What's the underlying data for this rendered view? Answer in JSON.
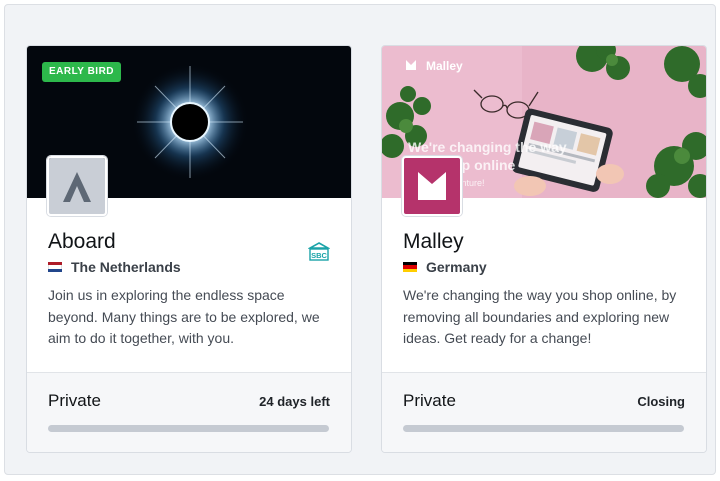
{
  "cards": [
    {
      "badge": "EARLY BIRD",
      "name": "Aboard",
      "country": "The Netherlands",
      "flag_colors": [
        "#ae1c28",
        "#ffffff",
        "#21468b"
      ],
      "description": "Join us in exploring the endless space beyond. Many things are to be explored, we aim to do it together, with you.",
      "badge_icon": "sbc-icon",
      "type": "Private",
      "status": "24 days left",
      "progress": 0
    },
    {
      "name": "Malley",
      "country": "Germany",
      "flag_colors": [
        "#000000",
        "#dd0000",
        "#ffce00"
      ],
      "description": "We're changing the way you shop online, by removing all boundaries and exploring new ideas. Get ready for a change!",
      "banner": {
        "brand": "Malley",
        "headline_line1": "We're changing the way",
        "headline_line2": "you shop online",
        "tagline": "Join the adventure!"
      },
      "type": "Private",
      "status": "Closing",
      "progress": 0
    }
  ],
  "colors": {
    "accent_green": "#2db84b",
    "malley_brand": "#b5336b",
    "progress_track": "#c5cad2"
  }
}
